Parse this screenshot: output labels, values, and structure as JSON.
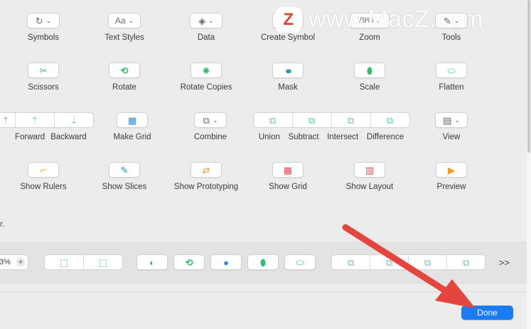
{
  "rows": [
    [
      {
        "id": "symbols",
        "label": "Symbols",
        "icon": "symbols-icon",
        "glyph": "↻"
      },
      {
        "id": "text-styles",
        "label": "Text Styles",
        "icon": "text-styles-icon",
        "glyph": "Aa"
      },
      {
        "id": "data",
        "label": "Data",
        "icon": "data-stack-icon",
        "glyph": "◈"
      },
      {
        "id": "create-symbol",
        "label": "Create Symbol",
        "icon": "create-symbol-icon",
        "glyph": "◇"
      },
      {
        "id": "zoom",
        "label": "Zoom",
        "icon": "zoom-icon",
        "glyph": "79%"
      },
      {
        "id": "tools",
        "label": "Tools",
        "icon": "tools-icon",
        "glyph": "✎"
      }
    ],
    [
      {
        "id": "scissors",
        "label": "Scissors",
        "icon": "scissors-icon",
        "glyph": "✂"
      },
      {
        "id": "rotate",
        "label": "Rotate",
        "icon": "rotate-icon",
        "glyph": "⟲"
      },
      {
        "id": "rotate-copies",
        "label": "Rotate Copies",
        "icon": "rotate-copies-icon",
        "glyph": "✺"
      },
      {
        "id": "mask",
        "label": "Mask",
        "icon": "mask-icon",
        "glyph": "●"
      },
      {
        "id": "scale",
        "label": "Scale",
        "icon": "scale-icon",
        "glyph": "⬮"
      },
      {
        "id": "flatten",
        "label": "Flatten",
        "icon": "flatten-icon",
        "glyph": "⬭"
      }
    ],
    [
      {
        "id": "make-grid",
        "label": "Make Grid",
        "icon": "make-grid-icon",
        "glyph": "▦"
      },
      {
        "id": "combine",
        "label": "Combine",
        "icon": "combine-icon",
        "glyph": "⧉"
      },
      {
        "id": "view",
        "label": "View",
        "icon": "view-icon",
        "glyph": "▤"
      }
    ],
    [
      {
        "id": "show-rulers",
        "label": "Show Rulers",
        "icon": "rulers-icon",
        "glyph": "⌐"
      },
      {
        "id": "show-slices",
        "label": "Show Slices",
        "icon": "slices-icon",
        "glyph": "✎"
      },
      {
        "id": "show-prototyping",
        "label": "Show Prototyping",
        "icon": "prototyping-icon",
        "glyph": "⇄"
      },
      {
        "id": "show-grid",
        "label": "Show Grid",
        "icon": "grid-icon",
        "glyph": "▦"
      },
      {
        "id": "show-layout",
        "label": "Show Layout",
        "icon": "layout-icon",
        "glyph": "▥"
      },
      {
        "id": "preview",
        "label": "Preview",
        "icon": "preview-play-icon",
        "glyph": "▶"
      }
    ]
  ],
  "arrange": {
    "forward": "Forward",
    "backward": "Backward"
  },
  "boolean_ops": {
    "union": "Union",
    "subtract": "Subtract",
    "intersect": "Intersect",
    "difference": "Difference"
  },
  "hint_text": "r.",
  "default_bar": {
    "zoom_value": "3%",
    "plus": "+",
    "more": ">>"
  },
  "done_label": "Done",
  "watermark": {
    "logo": "Z",
    "text": "www.MacZ.com"
  },
  "colors": {
    "accent": "#1a7cf4",
    "icon_green": "#2fbf6b",
    "icon_blue": "#2a8de0",
    "icon_red": "#e24b4b",
    "arrow": "#e5453d"
  }
}
